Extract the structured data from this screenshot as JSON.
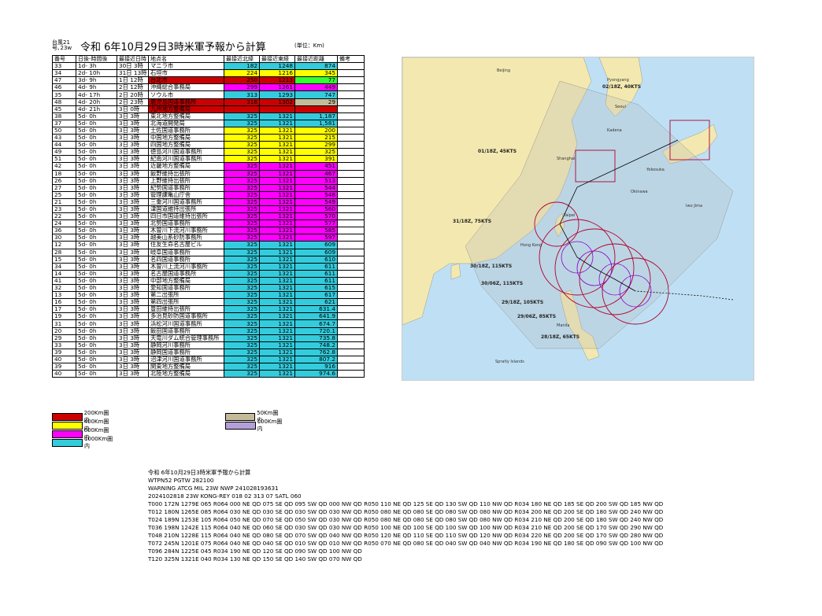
{
  "header": {
    "id_line1": "台風21",
    "id_line2": "号､23w",
    "title": "令和 6年10月29日3時米軍予報から計算",
    "unit": "(単位：Km)"
  },
  "table": {
    "headers": [
      "番号",
      "日後-時間後",
      "最接近日時",
      "地点名",
      "最接近北緯",
      "最接近東経",
      "最接近距離",
      "備考"
    ],
    "rows": [
      [
        "33",
        "1d- 3h",
        "30日 3時",
        "マニラ市",
        "182",
        "1248",
        "874",
        "cyan"
      ],
      [
        "34",
        "2d- 10h",
        "31日 13時",
        "石垣市",
        "224",
        "1216",
        "345",
        "yellow"
      ],
      [
        "47",
        "3d- 9h",
        "1日 12時",
        "台北市",
        "250",
        "1213",
        "77",
        "red"
      ],
      [
        "46",
        "4d- 9h",
        "2日 12時",
        "沖縄総合事務局",
        "299",
        "1261",
        "449",
        "magenta"
      ],
      [
        "35",
        "4d- 17h",
        "2日 20時",
        "ソウル市",
        "313",
        "1293",
        "747",
        "cyan"
      ],
      [
        "48",
        "4d- 20h",
        "2日 23時",
        "鹿児島国道事務所",
        "318",
        "1302",
        "29",
        "red"
      ],
      [
        "45",
        "4d- 21h",
        "3日 0時",
        "九州地方整備局",
        "",
        "",
        "",
        "red"
      ],
      [
        "38",
        "5d- 0h",
        "3日 3時",
        "東北地方整備局",
        "325",
        "1321",
        "1,187",
        "cyan"
      ],
      [
        "37",
        "5d- 0h",
        "3日 3時",
        "北海道開発局",
        "325",
        "1321",
        "1,581",
        "cyan"
      ],
      [
        "50",
        "5d- 0h",
        "3日 3時",
        "土佐国道事務所",
        "325",
        "1321",
        "200",
        "yellow"
      ],
      [
        "43",
        "5d- 0h",
        "3日 3時",
        "中国地方整備局",
        "325",
        "1321",
        "215",
        "yellow"
      ],
      [
        "44",
        "5d- 0h",
        "3日 3時",
        "四国地方整備局",
        "325",
        "1321",
        "299",
        "yellow"
      ],
      [
        "49",
        "5d- 0h",
        "3日 3時",
        "徳島河川国道事務所",
        "325",
        "1321",
        "325",
        "yellow"
      ],
      [
        "51",
        "5d- 0h",
        "3日 3時",
        "紀南河川国道事務所",
        "325",
        "1321",
        "391",
        "yellow"
      ],
      [
        "42",
        "5d- 0h",
        "3日 3時",
        "近畿地方整備局",
        "325",
        "1321",
        "451",
        "magenta"
      ],
      [
        "18",
        "5d- 0h",
        "3日 3時",
        "飯野維持出張所",
        "325",
        "1321",
        "467",
        "magenta"
      ],
      [
        "26",
        "5d- 0h",
        "3日 3時",
        "上野維持出張所",
        "325",
        "1321",
        "513",
        "magenta"
      ],
      [
        "27",
        "5d- 0h",
        "3日 3時",
        "紀勢国道事務所",
        "325",
        "1321",
        "544",
        "magenta"
      ],
      [
        "25",
        "5d- 0h",
        "3日 3時",
        "管理課亀山庁舎",
        "325",
        "1321",
        "548",
        "magenta"
      ],
      [
        "21",
        "5d- 0h",
        "3日 3時",
        "三重河川国道事務所",
        "325",
        "1321",
        "549",
        "magenta"
      ],
      [
        "23",
        "5d- 0h",
        "3日 3時",
        "津国道維持出張所",
        "325",
        "1321",
        "560",
        "magenta"
      ],
      [
        "22",
        "5d- 0h",
        "3日 3時",
        "四日市国道維持出張所",
        "325",
        "1321",
        "570",
        "magenta"
      ],
      [
        "24",
        "5d- 0h",
        "3日 3時",
        "北勢国道事務所",
        "325",
        "1321",
        "577",
        "magenta"
      ],
      [
        "36",
        "5d- 0h",
        "3日 3時",
        "木曽川下流河川事務所",
        "325",
        "1321",
        "585",
        "magenta"
      ],
      [
        "30",
        "5d- 0h",
        "3日 3時",
        "越美山系砂防事務所",
        "325",
        "1321",
        "597",
        "magenta"
      ],
      [
        "12",
        "5d- 0h",
        "3日 3時",
        "住友生命名古屋ビル",
        "325",
        "1321",
        "609",
        "cyan"
      ],
      [
        "28",
        "5d- 0h",
        "3日 3時",
        "岐阜国道事務所",
        "325",
        "1321",
        "609",
        "cyan"
      ],
      [
        "15",
        "5d- 0h",
        "3日 3時",
        "名四国道事務所",
        "325",
        "1321",
        "610",
        "cyan"
      ],
      [
        "34",
        "5d- 0h",
        "3日 3時",
        "木曽川上流河川事務所",
        "325",
        "1321",
        "611",
        "cyan"
      ],
      [
        "14",
        "5d- 0h",
        "3日 3時",
        "名古屋国道事務所",
        "325",
        "1321",
        "611",
        "cyan"
      ],
      [
        "41",
        "5d- 0h",
        "3日 3時",
        "中部地方整備局",
        "325",
        "1321",
        "611",
        "cyan"
      ],
      [
        "32",
        "5d- 0h",
        "3日 3時",
        "愛知国道事務所",
        "325",
        "1321",
        "615",
        "cyan"
      ],
      [
        "13",
        "5d- 0h",
        "3日 3時",
        "第二出張所",
        "325",
        "1321",
        "617",
        "cyan"
      ],
      [
        "16",
        "5d- 0h",
        "3日 3時",
        "第四出張所",
        "325",
        "1321",
        "621",
        "cyan"
      ],
      [
        "17",
        "5d- 0h",
        "3日 3時",
        "豊田維持出張所",
        "325",
        "1321",
        "631.4",
        "cyan"
      ],
      [
        "19",
        "5d- 0h",
        "3日 3時",
        "多治見砂防国道事務所",
        "325",
        "1321",
        "641.9",
        "cyan"
      ],
      [
        "31",
        "5d- 0h",
        "3日 3時",
        "浜松河川国道事務所",
        "325",
        "1321",
        "674.7",
        "cyan"
      ],
      [
        "20",
        "5d- 0h",
        "3日 3時",
        "飯田国道事務所",
        "325",
        "1321",
        "720.1",
        "cyan"
      ],
      [
        "29",
        "5d- 0h",
        "3日 3時",
        "天竜川ダム統合管理事務所",
        "325",
        "1321",
        "735.8",
        "cyan"
      ],
      [
        "33",
        "5d- 0h",
        "3日 3時",
        "静岡河川事務所",
        "325",
        "1321",
        "748.2",
        "cyan"
      ],
      [
        "39",
        "5d- 0h",
        "3日 3時",
        "静岡国道事務所",
        "325",
        "1321",
        "762.8",
        "cyan"
      ],
      [
        "40",
        "5d- 0h",
        "3日 3時",
        "沼津河川国道事務所",
        "325",
        "1321",
        "807.2",
        "cyan"
      ],
      [
        "39",
        "5d- 0h",
        "3日 3時",
        "関東地方整備局",
        "325",
        "1321",
        "916",
        "cyan"
      ],
      [
        "40",
        "5d- 0h",
        "3日 3時",
        "北陸地方整備局",
        "325",
        "1321",
        "974.6",
        "cyan"
      ]
    ]
  },
  "legend": {
    "l200": "200Km圏内",
    "l400": "400Km圏内",
    "l600": "600Km圏内",
    "l1000": "1000Km圏内",
    "l50": "50Km圏内",
    "l100": "100Km圏内"
  },
  "colors": {
    "red": "#cc0000",
    "yellow": "#ffff00",
    "magenta": "#ff00ff",
    "cyan": "#33ccdd",
    "green": "#33ff33",
    "tan": "#c4bb99",
    "lavender": "#b4a0d8"
  },
  "map": {
    "labels": {
      "l1": "01/18Z, 45KTS",
      "l2": "31/18Z, 75KTS",
      "l3": "30/18Z, 115KTS",
      "l4": "30/06Z, 115KTS",
      "l5": "29/18Z, 105KTS",
      "l6": "29/06Z, 85KTS",
      "l7": "28/18Z, 65KTS",
      "l8": "02/18Z, 40KTS"
    },
    "places": {
      "p1": "Beijing",
      "p2": "Pyongyang",
      "p3": "Seoul",
      "p4": "Kadena",
      "p5": "Shanghai",
      "p6": "Taipei",
      "p7": "Okinawa",
      "p8": "Hong Kong",
      "p9": "Manila",
      "p10": "Spratly Islands",
      "p11": "Yokosuka",
      "p12": "Iwo Jima"
    }
  },
  "forecast": {
    "lines": [
      "令和 6年10月29日3時米軍予報から計算",
      "WTPN52 PGTW 282100",
      "WARNING   ATCG MIL 23W NWP 241028193631",
      "2024102818 23W KONG-REY   018   02 313 07 SATL 060",
      "T000 172N 1279E 065 R064 000 NE QD 075 SE QD 095 SW QD 000 NW QD R050 110 NE QD 125 SE QD 130 SW QD 110 NW QD R034 180 NE QD 185 SE QD 200 SW QD 185 NW QD",
      "T012 180N 1265E 085 R064 030 NE QD 030 SE QD 030 SW QD 030 NW QD R050 080 NE QD 080 SE QD 080 SW QD 080 NW QD R034 200 NE QD 200 SE QD 180 SW QD 240 NW QD",
      "T024 189N 1253E 105 R064 050 NE QD 070 SE QD 050 SW QD 030 NW QD R050 080 NE QD 080 SE QD 080 SW QD 080 NW QD R034 210 NE QD 200 SE QD 180 SW QD 240 NW QD",
      "T036 198N 1242E 115 R064 040 NE QD 060 SE QD 030 SW QD 030 NW QD R050 100 NE QD 100 SE QD 100 SW QD 100 NW QD R034 210 NE QD 200 SE QD 170 SW QD 290 NW QD",
      "T048 210N 1228E 115 R064 040 NE QD 080 SE QD 070 SW QD 040 NW QD R050 120 NE QD 110 SE QD 110 SW QD 120 NW QD R034 220 NE QD 200 SE QD 170 SW QD 280 NW QD",
      "T072 245N 1201E 075 R064 040 NE QD 040 SE QD 010 SW QD 010 NW QD R050 070 NE QD 080 SE QD 040 SW QD 040 NW QD R034 190 NE QD 180 SE QD 090 SW QD 100 NW QD",
      "T096 284N 1225E 045 R034 190 NE QD 120 SE QD 090 SW QD 100 NW QD",
      "T120 325N 1321E 040 R034 130 NE QD 150 SE QD 140 SW QD 070 NW QD"
    ]
  }
}
